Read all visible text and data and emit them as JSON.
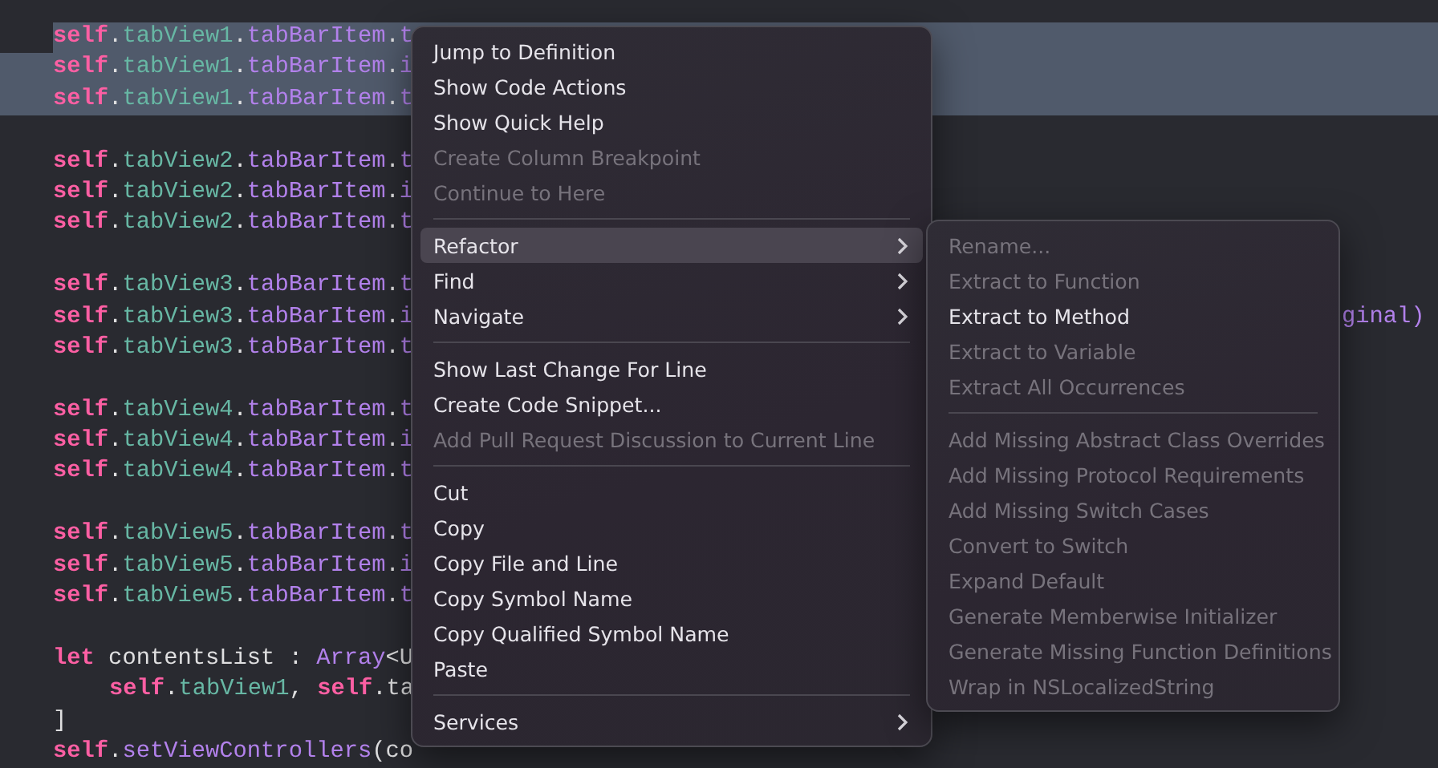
{
  "code_lines": [
    {
      "kind": "code",
      "selected": true,
      "indent": false,
      "tokens": [
        {
          "kind": "keyword",
          "text": "self"
        },
        {
          "kind": "plain",
          "text": "."
        },
        {
          "kind": "var",
          "text": "tabView1"
        },
        {
          "kind": "plain",
          "text": "."
        },
        {
          "kind": "member",
          "text": "tabBarItem"
        },
        {
          "kind": "plain",
          "text": "."
        },
        {
          "kind": "member",
          "text": "t"
        }
      ]
    },
    {
      "kind": "code",
      "selected": true,
      "indent": false,
      "tokens": [
        {
          "kind": "keyword",
          "text": "self"
        },
        {
          "kind": "plain",
          "text": "."
        },
        {
          "kind": "var",
          "text": "tabView1"
        },
        {
          "kind": "plain",
          "text": "."
        },
        {
          "kind": "member",
          "text": "tabBarItem"
        },
        {
          "kind": "plain",
          "text": "."
        },
        {
          "kind": "member",
          "text": "i"
        }
      ]
    },
    {
      "kind": "code",
      "selected": true,
      "indent": false,
      "tokens": [
        {
          "kind": "keyword",
          "text": "self"
        },
        {
          "kind": "plain",
          "text": "."
        },
        {
          "kind": "var",
          "text": "tabView1"
        },
        {
          "kind": "plain",
          "text": "."
        },
        {
          "kind": "member",
          "text": "tabBarItem"
        },
        {
          "kind": "plain",
          "text": "."
        },
        {
          "kind": "member",
          "text": "t"
        }
      ]
    },
    {
      "kind": "blank"
    },
    {
      "kind": "code",
      "selected": false,
      "indent": false,
      "tokens": [
        {
          "kind": "keyword",
          "text": "self"
        },
        {
          "kind": "plain",
          "text": "."
        },
        {
          "kind": "var",
          "text": "tabView2"
        },
        {
          "kind": "plain",
          "text": "."
        },
        {
          "kind": "member",
          "text": "tabBarItem"
        },
        {
          "kind": "plain",
          "text": "."
        },
        {
          "kind": "member",
          "text": "t"
        }
      ]
    },
    {
      "kind": "code",
      "selected": false,
      "indent": false,
      "tokens": [
        {
          "kind": "keyword",
          "text": "self"
        },
        {
          "kind": "plain",
          "text": "."
        },
        {
          "kind": "var",
          "text": "tabView2"
        },
        {
          "kind": "plain",
          "text": "."
        },
        {
          "kind": "member",
          "text": "tabBarItem"
        },
        {
          "kind": "plain",
          "text": "."
        },
        {
          "kind": "member",
          "text": "i"
        }
      ]
    },
    {
      "kind": "code",
      "selected": false,
      "indent": false,
      "tokens": [
        {
          "kind": "keyword",
          "text": "self"
        },
        {
          "kind": "plain",
          "text": "."
        },
        {
          "kind": "var",
          "text": "tabView2"
        },
        {
          "kind": "plain",
          "text": "."
        },
        {
          "kind": "member",
          "text": "tabBarItem"
        },
        {
          "kind": "plain",
          "text": "."
        },
        {
          "kind": "member",
          "text": "t"
        }
      ]
    },
    {
      "kind": "blank"
    },
    {
      "kind": "code",
      "selected": false,
      "indent": false,
      "tokens": [
        {
          "kind": "keyword",
          "text": "self"
        },
        {
          "kind": "plain",
          "text": "."
        },
        {
          "kind": "var",
          "text": "tabView3"
        },
        {
          "kind": "plain",
          "text": "."
        },
        {
          "kind": "member",
          "text": "tabBarItem"
        },
        {
          "kind": "plain",
          "text": "."
        },
        {
          "kind": "member",
          "text": "t"
        }
      ]
    },
    {
      "kind": "code",
      "selected": false,
      "indent": false,
      "tokens": [
        {
          "kind": "keyword",
          "text": "self"
        },
        {
          "kind": "plain",
          "text": "."
        },
        {
          "kind": "var",
          "text": "tabView3"
        },
        {
          "kind": "plain",
          "text": "."
        },
        {
          "kind": "member",
          "text": "tabBarItem"
        },
        {
          "kind": "plain",
          "text": "."
        },
        {
          "kind": "member",
          "text": "i"
        }
      ],
      "tail": "ginal)"
    },
    {
      "kind": "code",
      "selected": false,
      "indent": false,
      "tokens": [
        {
          "kind": "keyword",
          "text": "self"
        },
        {
          "kind": "plain",
          "text": "."
        },
        {
          "kind": "var",
          "text": "tabView3"
        },
        {
          "kind": "plain",
          "text": "."
        },
        {
          "kind": "member",
          "text": "tabBarItem"
        },
        {
          "kind": "plain",
          "text": "."
        },
        {
          "kind": "member",
          "text": "t"
        }
      ]
    },
    {
      "kind": "blank"
    },
    {
      "kind": "code",
      "selected": false,
      "indent": false,
      "tokens": [
        {
          "kind": "keyword",
          "text": "self"
        },
        {
          "kind": "plain",
          "text": "."
        },
        {
          "kind": "var",
          "text": "tabView4"
        },
        {
          "kind": "plain",
          "text": "."
        },
        {
          "kind": "member",
          "text": "tabBarItem"
        },
        {
          "kind": "plain",
          "text": "."
        },
        {
          "kind": "member",
          "text": "t"
        }
      ]
    },
    {
      "kind": "code",
      "selected": false,
      "indent": false,
      "tokens": [
        {
          "kind": "keyword",
          "text": "self"
        },
        {
          "kind": "plain",
          "text": "."
        },
        {
          "kind": "var",
          "text": "tabView4"
        },
        {
          "kind": "plain",
          "text": "."
        },
        {
          "kind": "member",
          "text": "tabBarItem"
        },
        {
          "kind": "plain",
          "text": "."
        },
        {
          "kind": "member",
          "text": "i"
        }
      ]
    },
    {
      "kind": "code",
      "selected": false,
      "indent": false,
      "tokens": [
        {
          "kind": "keyword",
          "text": "self"
        },
        {
          "kind": "plain",
          "text": "."
        },
        {
          "kind": "var",
          "text": "tabView4"
        },
        {
          "kind": "plain",
          "text": "."
        },
        {
          "kind": "member",
          "text": "tabBarItem"
        },
        {
          "kind": "plain",
          "text": "."
        },
        {
          "kind": "member",
          "text": "t"
        }
      ]
    },
    {
      "kind": "blank"
    },
    {
      "kind": "code",
      "selected": false,
      "indent": false,
      "tokens": [
        {
          "kind": "keyword",
          "text": "self"
        },
        {
          "kind": "plain",
          "text": "."
        },
        {
          "kind": "var",
          "text": "tabView5"
        },
        {
          "kind": "plain",
          "text": "."
        },
        {
          "kind": "member",
          "text": "tabBarItem"
        },
        {
          "kind": "plain",
          "text": "."
        },
        {
          "kind": "member",
          "text": "t"
        }
      ]
    },
    {
      "kind": "code",
      "selected": false,
      "indent": false,
      "tokens": [
        {
          "kind": "keyword",
          "text": "self"
        },
        {
          "kind": "plain",
          "text": "."
        },
        {
          "kind": "var",
          "text": "tabView5"
        },
        {
          "kind": "plain",
          "text": "."
        },
        {
          "kind": "member",
          "text": "tabBarItem"
        },
        {
          "kind": "plain",
          "text": "."
        },
        {
          "kind": "member",
          "text": "i"
        }
      ]
    },
    {
      "kind": "code",
      "selected": false,
      "indent": false,
      "tokens": [
        {
          "kind": "keyword",
          "text": "self"
        },
        {
          "kind": "plain",
          "text": "."
        },
        {
          "kind": "var",
          "text": "tabView5"
        },
        {
          "kind": "plain",
          "text": "."
        },
        {
          "kind": "member",
          "text": "tabBarItem"
        },
        {
          "kind": "plain",
          "text": "."
        },
        {
          "kind": "member",
          "text": "t"
        }
      ]
    },
    {
      "kind": "blank"
    },
    {
      "kind": "code",
      "selected": false,
      "indent": false,
      "tokens": [
        {
          "kind": "keyword",
          "text": "let"
        },
        {
          "kind": "plain",
          "text": " contentsList : "
        },
        {
          "kind": "member",
          "text": "Array"
        },
        {
          "kind": "plain",
          "text": "<U"
        }
      ]
    },
    {
      "kind": "code",
      "selected": false,
      "indent": true,
      "tokens": [
        {
          "kind": "keyword",
          "text": "self"
        },
        {
          "kind": "plain",
          "text": "."
        },
        {
          "kind": "var",
          "text": "tabView1"
        },
        {
          "kind": "plain",
          "text": ", "
        },
        {
          "kind": "keyword",
          "text": "self"
        },
        {
          "kind": "plain",
          "text": ".ta"
        }
      ]
    },
    {
      "kind": "code",
      "selected": false,
      "indent": false,
      "tokens": [
        {
          "kind": "plain",
          "text": "]"
        }
      ]
    },
    {
      "kind": "code",
      "selected": false,
      "indent": false,
      "tokens": [
        {
          "kind": "keyword",
          "text": "self"
        },
        {
          "kind": "plain",
          "text": "."
        },
        {
          "kind": "member",
          "text": "setViewControllers"
        },
        {
          "kind": "plain",
          "text": "(co"
        }
      ]
    }
  ],
  "context_menu": {
    "items": [
      {
        "kind": "item",
        "label": "Jump to Definition",
        "disabled": false,
        "submenu": false,
        "selected": false
      },
      {
        "kind": "item",
        "label": "Show Code Actions",
        "disabled": false,
        "submenu": false,
        "selected": false
      },
      {
        "kind": "item",
        "label": "Show Quick Help",
        "disabled": false,
        "submenu": false,
        "selected": false
      },
      {
        "kind": "item",
        "label": "Create Column Breakpoint",
        "disabled": true,
        "submenu": false,
        "selected": false
      },
      {
        "kind": "item",
        "label": "Continue to Here",
        "disabled": true,
        "submenu": false,
        "selected": false
      },
      {
        "kind": "separator"
      },
      {
        "kind": "item",
        "label": "Refactor",
        "disabled": false,
        "submenu": true,
        "selected": true
      },
      {
        "kind": "item",
        "label": "Find",
        "disabled": false,
        "submenu": true,
        "selected": false
      },
      {
        "kind": "item",
        "label": "Navigate",
        "disabled": false,
        "submenu": true,
        "selected": false
      },
      {
        "kind": "separator"
      },
      {
        "kind": "item",
        "label": "Show Last Change For Line",
        "disabled": false,
        "submenu": false,
        "selected": false
      },
      {
        "kind": "item",
        "label": "Create Code Snippet...",
        "disabled": false,
        "submenu": false,
        "selected": false
      },
      {
        "kind": "item",
        "label": "Add Pull Request Discussion to Current Line",
        "disabled": true,
        "submenu": false,
        "selected": false
      },
      {
        "kind": "separator"
      },
      {
        "kind": "item",
        "label": "Cut",
        "disabled": false,
        "submenu": false,
        "selected": false
      },
      {
        "kind": "item",
        "label": "Copy",
        "disabled": false,
        "submenu": false,
        "selected": false
      },
      {
        "kind": "item",
        "label": "Copy File and Line",
        "disabled": false,
        "submenu": false,
        "selected": false
      },
      {
        "kind": "item",
        "label": "Copy Symbol Name",
        "disabled": false,
        "submenu": false,
        "selected": false
      },
      {
        "kind": "item",
        "label": "Copy Qualified Symbol Name",
        "disabled": false,
        "submenu": false,
        "selected": false
      },
      {
        "kind": "item",
        "label": "Paste",
        "disabled": false,
        "submenu": false,
        "selected": false
      },
      {
        "kind": "separator"
      },
      {
        "kind": "item",
        "label": "Services",
        "disabled": false,
        "submenu": true,
        "selected": false
      }
    ]
  },
  "refactor_submenu": {
    "items": [
      {
        "kind": "item",
        "label": "Rename...",
        "disabled": true
      },
      {
        "kind": "item",
        "label": "Extract to Function",
        "disabled": true
      },
      {
        "kind": "item",
        "label": "Extract to Method",
        "disabled": false
      },
      {
        "kind": "item",
        "label": "Extract to Variable",
        "disabled": true
      },
      {
        "kind": "item",
        "label": "Extract All Occurrences",
        "disabled": true
      },
      {
        "kind": "separator"
      },
      {
        "kind": "item",
        "label": "Add Missing Abstract Class Overrides",
        "disabled": true
      },
      {
        "kind": "item",
        "label": "Add Missing Protocol Requirements",
        "disabled": true
      },
      {
        "kind": "item",
        "label": "Add Missing Switch Cases",
        "disabled": true
      },
      {
        "kind": "item",
        "label": "Convert to Switch",
        "disabled": true
      },
      {
        "kind": "item",
        "label": "Expand Default",
        "disabled": true
      },
      {
        "kind": "item",
        "label": "Generate Memberwise Initializer",
        "disabled": true
      },
      {
        "kind": "item",
        "label": "Generate Missing Function Definitions",
        "disabled": true
      },
      {
        "kind": "item",
        "label": "Wrap in NSLocalizedString",
        "disabled": true
      }
    ]
  }
}
